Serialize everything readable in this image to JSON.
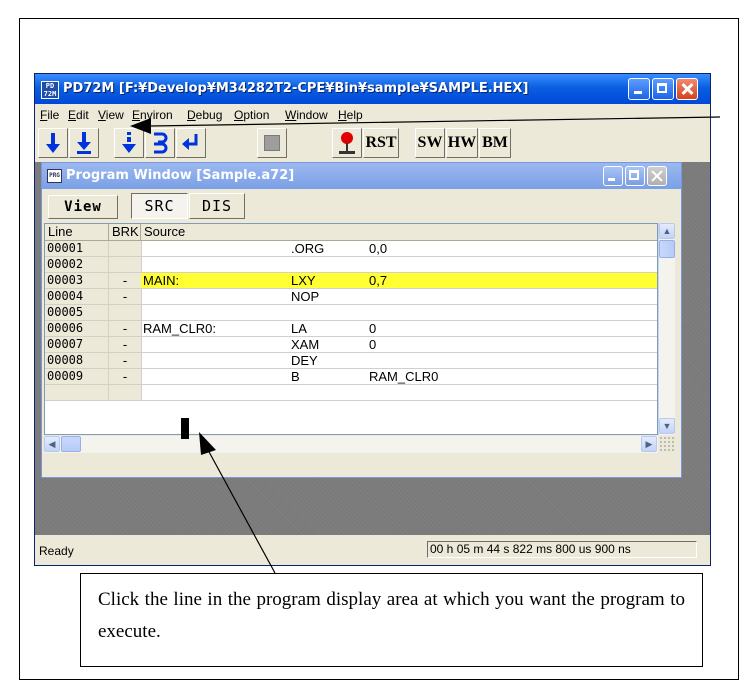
{
  "app": {
    "title": "PD72M [F:¥Develop¥M34282T2-CPE¥Bin¥sample¥SAMPLE.HEX]",
    "icon_label": "PD\n72M"
  },
  "menu": [
    "File",
    "Edit",
    "View",
    "Environ",
    "Debug",
    "Option",
    "Window",
    "Help"
  ],
  "toolbar": {
    "buttons": [
      {
        "name": "go-icon",
        "glyph": "↓"
      },
      {
        "name": "go-free-icon",
        "glyph": "⭳"
      },
      {
        "name": "step-icon",
        "glyph": "⇣"
      },
      {
        "name": "over-icon",
        "glyph": "⇉"
      },
      {
        "name": "return-icon",
        "glyph": "↵"
      },
      {
        "name": "stop-icon",
        "glyph": ""
      },
      {
        "name": "breakpoint-pin-icon",
        "glyph": ""
      }
    ],
    "rst_label": "RST",
    "sw_label": "SW",
    "hw_label": "HW",
    "bm_label": "BM"
  },
  "program_window": {
    "title": "Program Window [Sample.a72]",
    "icon_label": "PRG",
    "view_label": "View",
    "tab_src": "SRC",
    "tab_dis": "DIS",
    "columns": {
      "line": "Line",
      "brk": "BRK",
      "source": "Source"
    },
    "highlight_color": "#ffff33",
    "rows": [
      {
        "line": "00001",
        "brk": "",
        "label": "",
        "op": ".ORG",
        "arg": "0,0",
        "highlight": false
      },
      {
        "line": "00002",
        "brk": "",
        "label": "",
        "op": "",
        "arg": "",
        "highlight": false
      },
      {
        "line": "00003",
        "brk": "-",
        "label": "MAIN:",
        "op": "LXY",
        "arg": "0,7",
        "highlight": true
      },
      {
        "line": "00004",
        "brk": "-",
        "label": "",
        "op": "NOP",
        "arg": "",
        "highlight": false
      },
      {
        "line": "00005",
        "brk": "",
        "label": "",
        "op": "",
        "arg": "",
        "highlight": false
      },
      {
        "line": "00006",
        "brk": "-",
        "label": "RAM_CLR0:",
        "op": "LA",
        "arg": "0",
        "highlight": false
      },
      {
        "line": "00007",
        "brk": "-",
        "label": "",
        "op": "XAM",
        "arg": "0",
        "highlight": false
      },
      {
        "line": "00008",
        "brk": "-",
        "label": "",
        "op": "DEY",
        "arg": "",
        "highlight": false
      },
      {
        "line": "00009",
        "brk": "-",
        "label": "",
        "op": "B",
        "arg": "RAM_CLR0",
        "highlight": false
      },
      {
        "line": "",
        "brk": "",
        "label": "",
        "op": "",
        "arg": "",
        "highlight": false
      }
    ]
  },
  "status": {
    "left": "Ready",
    "right": "00 h 05 m 44 s 822 ms 800 us 900 ns"
  },
  "callout": {
    "text": "Click the line in the program display area at which you want the program to execute."
  }
}
